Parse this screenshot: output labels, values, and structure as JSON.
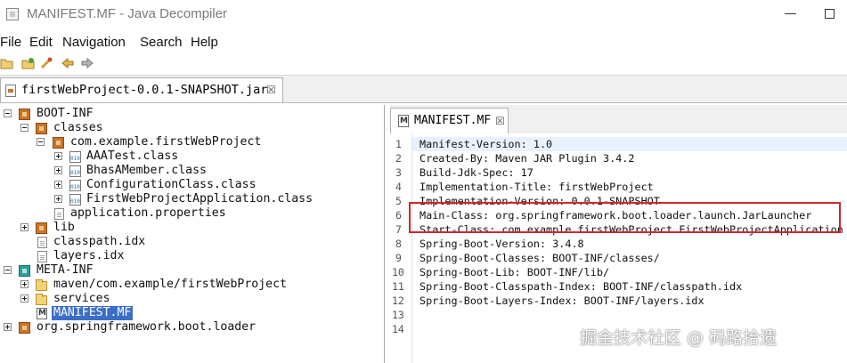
{
  "window": {
    "title": "MANIFEST.MF - Java Decompiler"
  },
  "menu": [
    "File",
    "Edit",
    "Navigation",
    "Search",
    "Help"
  ],
  "toolbar": {
    "icons": [
      "open-file-icon",
      "open-type-icon",
      "search-icon",
      "back-icon",
      "forward-icon"
    ]
  },
  "editor_tab": {
    "label": "firstWebProject-0.0.1-SNAPSHOT.jar",
    "close": "☒"
  },
  "tree": {
    "items": [
      {
        "label": "BOOT-INF"
      },
      {
        "label": "classes"
      },
      {
        "label": "com.example.firstWebProject"
      },
      {
        "label": "AAATest.class"
      },
      {
        "label": "BhasAMember.class"
      },
      {
        "label": "ConfigurationClass.class"
      },
      {
        "label": "FirstWebProjectApplication.class"
      },
      {
        "label": "application.properties"
      },
      {
        "label": "lib"
      },
      {
        "label": "classpath.idx"
      },
      {
        "label": "layers.idx"
      },
      {
        "label": "META-INF"
      },
      {
        "label": "maven/com.example/firstWebProject"
      },
      {
        "label": "services"
      },
      {
        "label": "MANIFEST.MF",
        "selected": true
      },
      {
        "label": "org.springframework.boot.loader"
      }
    ]
  },
  "file_tab": {
    "label": "MANIFEST.MF",
    "close": "☒"
  },
  "code": {
    "line_numbers": [
      "1",
      "2",
      "3",
      "4",
      "5",
      "6",
      "7",
      "8",
      "9",
      "10",
      "11",
      "12",
      "13",
      "14"
    ],
    "lines": [
      "Manifest-Version: 1.0",
      "Created-By: Maven JAR Plugin 3.4.2",
      "Build-Jdk-Spec: 17",
      "Implementation-Title: firstWebProject",
      "Implementation-Version: 0.0.1-SNAPSHOT",
      "Main-Class: org.springframework.boot.loader.launch.JarLauncher",
      "Start-Class: com.example.firstWebProject.FirstWebProjectApplication",
      "Spring-Boot-Version: 3.4.8",
      "Spring-Boot-Classes: BOOT-INF/classes/",
      "Spring-Boot-Lib: BOOT-INF/lib/",
      "Spring-Boot-Classpath-Index: BOOT-INF/classpath.idx",
      "Spring-Boot-Layers-Index: BOOT-INF/layers.idx",
      "",
      ""
    ]
  },
  "watermark": "掘金技术社区 @ 码路拾遗",
  "colors": {
    "selection": "#3b6ec9",
    "highlight_border": "#d2272f",
    "current_line": "#e8f2fe"
  }
}
